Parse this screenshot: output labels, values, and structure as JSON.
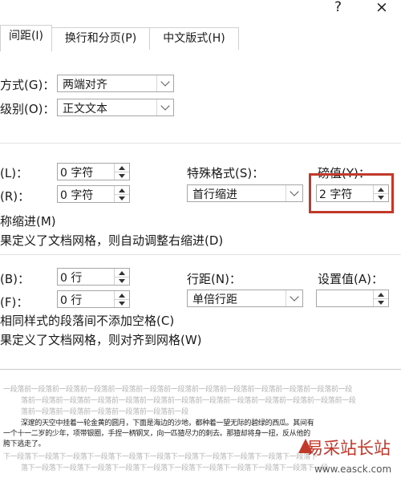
{
  "titlebar": {
    "help": "?",
    "close": "×"
  },
  "tabs": [
    {
      "label": "间距(I)"
    },
    {
      "label": "换行和分页(P)"
    },
    {
      "label": "中文版式(H)"
    }
  ],
  "general": {
    "alignment": {
      "label": "方式(G)：",
      "value": "两端对齐"
    },
    "outline": {
      "label": "级别(O)：",
      "value": "正文文本"
    }
  },
  "indent": {
    "left": {
      "label": "(L)：",
      "value": "0 字符"
    },
    "right": {
      "label": "(R)：",
      "value": "0 字符"
    },
    "special": {
      "label": "特殊格式(S)：",
      "value": "首行缩进"
    },
    "by": {
      "label": "磅值(Y)：",
      "value": "2 字符"
    },
    "mirror": "称缩进(M)",
    "auto_adjust": "果定义了文档网格，则自动调整右缩进(D)"
  },
  "spacing": {
    "before": {
      "label": "(B)：",
      "value": "0 行"
    },
    "after": {
      "label": "(F)：",
      "value": "0 行"
    },
    "line": {
      "label": "行距(N)：",
      "value": "单倍行距"
    },
    "at": {
      "label": "设置值(A)：",
      "value": ""
    },
    "no_space": "相同样式的段落间不添加空格(C)",
    "snap_grid": "果定义了文档网格，则对齐到网格(W)"
  },
  "preview": {
    "prev_line_1": "一段落前一段落前一段落前一段落前一段落前一段落前一段落前一段落前一段落前一段落前一段落前一段落前一段",
    "prev_line_2": "落前一段落前一段落前一段落前一段落前一段落前一段落前一段落前一段落前一段落前一段落前一段落前一段",
    "prev_line_3": "落前一段落前一段落前一段落前一段落前一段落前一段",
    "body_line_1": "深邃的天空中挂着一轮金黄的圆月，下面是海边的沙地，都种着一望无际的碧绿的西瓜。其间有",
    "body_line_2": "一个十一二岁的少年，项带银圈，手捏一柄钢叉，向一匹猹尽力的刺去。那猹却将身一扭，反从他的",
    "body_line_3": "胯下逃走了。",
    "next_line_1": "下一段落下一段落下一段落下一段落下一段落下一段落下一段落下一段落下一段落下一段落下一段落下",
    "next_line_2": "落下一段落下一段落下一段落下一段落下一段落下一段落下一段落下一段落下一段落下一段落下一段"
  },
  "watermark": {
    "title": "易采站长站",
    "url": "www.easck.com"
  },
  "colors": {
    "highlight": "#c0392b",
    "border": "#a6a6a6"
  }
}
